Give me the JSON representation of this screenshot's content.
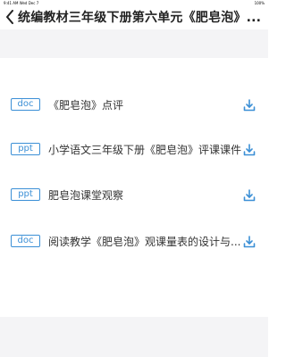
{
  "status_bar": {
    "time": "9:41 AM",
    "date": "Wed Dec 7",
    "battery": "100%"
  },
  "header": {
    "title": "统编教材三年级下册第六单元《肥皂泡》..."
  },
  "files": [
    {
      "type": "doc",
      "title": "《肥皂泡》点评"
    },
    {
      "type": "ppt",
      "title": "小学语文三年级下册《肥皂泡》评课课件"
    },
    {
      "type": "ppt",
      "title": "肥皂泡课堂观察"
    },
    {
      "type": "doc",
      "title": "阅读教学《肥皂泡》观课量表的设计与..."
    }
  ],
  "colors": {
    "accent": "#3b8fd6",
    "background": "#f4f4f6"
  },
  "icons": {
    "back": "chevron-left-icon",
    "download": "download-icon"
  }
}
